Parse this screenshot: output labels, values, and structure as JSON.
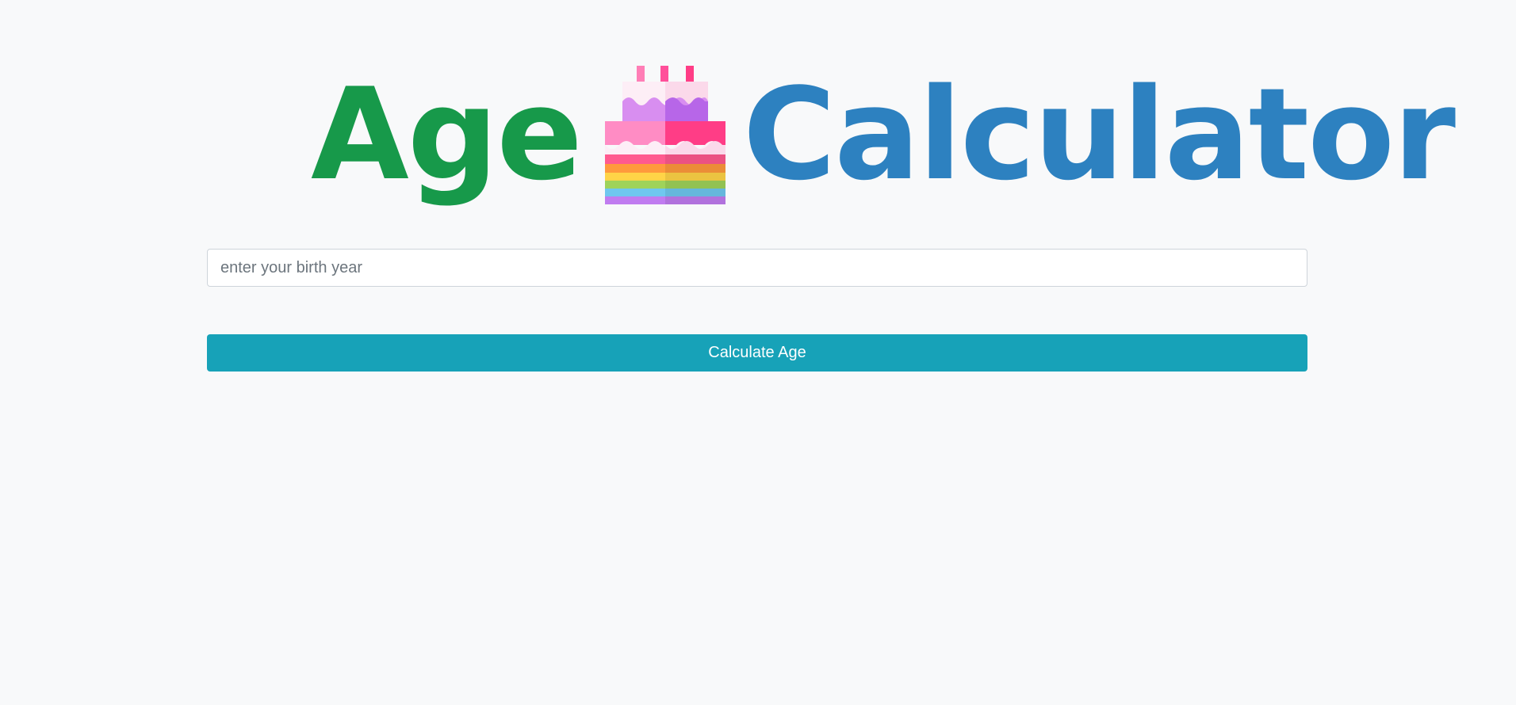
{
  "header": {
    "logo_word_1": "Age",
    "logo_word_2": "Calculator",
    "logo_icon": "birthday-cake-icon"
  },
  "form": {
    "birth_year_placeholder": "enter your birth year",
    "birth_year_value": "",
    "submit_label": "Calculate Age"
  },
  "colors": {
    "background": "#f8f9fa",
    "logo_age": "#17994a",
    "logo_calculator": "#2d81c0",
    "button": "#17a2b8",
    "button_text": "#ffffff"
  }
}
